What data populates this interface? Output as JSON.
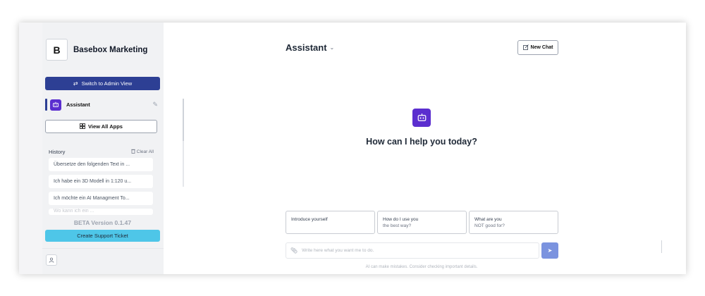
{
  "sidebar": {
    "brand_initial": "B",
    "brand_name": "Basebox Marketing",
    "switch_label": "Switch to Admin View",
    "active_app": "Assistant",
    "view_all_label": "View All Apps",
    "history_title": "History",
    "clear_all_label": "Clear All",
    "history": [
      "Übersetze den folgenden Text in ...",
      "Ich habe ein 3D Modell in 1:120 u...",
      "Ich möchte ein AI Managment To...",
      "Wo kann ich ein ..."
    ],
    "version": "BETA Version 0.1.47",
    "support_label": "Create Support Ticket"
  },
  "main": {
    "title": "Assistant",
    "new_chat_label": "New Chat",
    "hero_text": "How can I help you today?",
    "suggestions": [
      {
        "line1": "Introduce yourself",
        "line2": ""
      },
      {
        "line1": "How do I use you",
        "line2": "the best way?"
      },
      {
        "line1": "What are you",
        "line2": "NOT good for?"
      }
    ],
    "input_placeholder": "Write here what you want me to do.",
    "disclaimer": "AI can make mistakes. Consider checking important details."
  },
  "colors": {
    "primary": "#2d3f94",
    "app_purple": "#5b2ecf",
    "support": "#4ec6e8",
    "send": "#7b93df"
  },
  "icons": [
    "swap-icon",
    "robot-icon",
    "edit-icon",
    "grid-icon",
    "trash-icon",
    "user-icon",
    "chevron-down-icon",
    "new-chat-icon",
    "paperclip-icon",
    "send-icon"
  ]
}
